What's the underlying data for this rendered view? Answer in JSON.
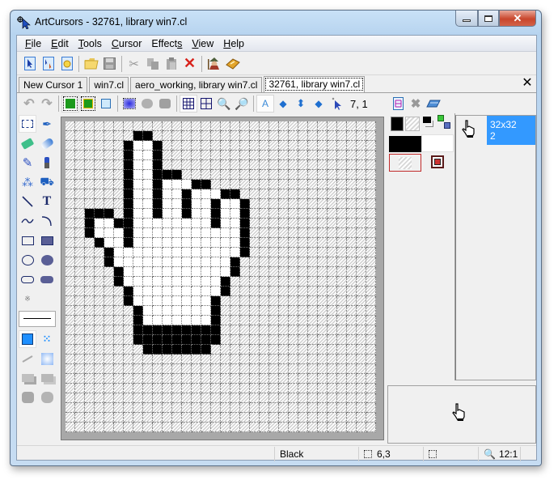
{
  "window": {
    "title": "ArtCursors - 32761, library win7.cl",
    "controls": {
      "minimize": "minimize",
      "maximize": "maximize",
      "close": "close"
    }
  },
  "menubar": {
    "items": [
      {
        "label": "File",
        "accel": "F"
      },
      {
        "label": "Edit",
        "accel": "E"
      },
      {
        "label": "Tools",
        "accel": "T"
      },
      {
        "label": "Cursor",
        "accel": "C"
      },
      {
        "label": "Effects",
        "accel": "s"
      },
      {
        "label": "View",
        "accel": "V"
      },
      {
        "label": "Help",
        "accel": "H"
      }
    ]
  },
  "toolbar": {
    "buttons": [
      {
        "name": "new-cursor",
        "icon": "new-cursor-icon"
      },
      {
        "name": "new-animated-cursor",
        "icon": "new-animated-cursor-icon"
      },
      {
        "name": "new-library",
        "icon": "new-library-icon"
      },
      {
        "name": "open",
        "icon": "folder-open-icon"
      },
      {
        "name": "save",
        "icon": "save-icon"
      },
      {
        "name": "cut",
        "icon": "scissors-icon"
      },
      {
        "name": "copy",
        "icon": "copy-icon"
      },
      {
        "name": "paste",
        "icon": "paste-icon"
      },
      {
        "name": "delete",
        "icon": "delete-x-icon"
      },
      {
        "name": "test-cursor",
        "icon": "wizard-icon"
      },
      {
        "name": "help-book",
        "icon": "help-book-icon"
      }
    ]
  },
  "tabs": [
    {
      "label": "New Cursor 1",
      "active": false
    },
    {
      "label": "win7.cl",
      "active": false
    },
    {
      "label": "aero_working, library win7.cl",
      "active": false
    },
    {
      "label": "32761, library win7.cl",
      "active": true
    }
  ],
  "edit_toolbar": {
    "coordinate": "7, 1"
  },
  "canvas": {
    "size": 32,
    "zoom": "12:1",
    "pixels": [
      "................................",
      ".......BB.......................",
      "......BWWB......................",
      "......BWWB......................",
      "......BWWB......................",
      "......BWWBBB....................",
      "......BWWBWWWBB.................",
      "......BWWBWWBWWWBB..............",
      "......BWWBWWBWWBWWB.............",
      "..BBB.BWWBWWBWWBWWB.............",
      "..BWWBBWWWWWWWWBWWB.............",
      "..BWWWBWWWWWWWWWWWB.............",
      "...BWWBWWWWWWWWWWWB.............",
      "....BWWWWWWWWWWWWWB.............",
      "....BWWWWWWWWWWWWB..............",
      ".....BWWWWWWWWWWWB..............",
      ".....BWWWWWWWWWWB...............",
      "......BWWWWWWWWWB...............",
      "......BWWWWWWWWB................",
      ".......BWWWWWWWB................",
      ".......BWWWWWWWB................",
      ".......BBBBBBBBB................",
      ".......BBBBBBBBB................",
      "........BBBBBBB.................",
      "................................",
      "................................",
      "................................",
      "................................",
      "................................",
      "................................",
      "................................",
      "................................"
    ]
  },
  "colors": {
    "primary": "#000000",
    "secondary": "transparent",
    "left_button": "#000000",
    "right_button": "#ffffff",
    "screen_color": "transparent",
    "inverse_color": "inverse"
  },
  "frames_list": {
    "items": [
      {
        "size": "32x32",
        "bpp": "2",
        "selected": true
      }
    ]
  },
  "statusbar": {
    "color_name": "Black",
    "cursor_position": "6,3",
    "selection_size": "",
    "zoom": "12:1"
  }
}
